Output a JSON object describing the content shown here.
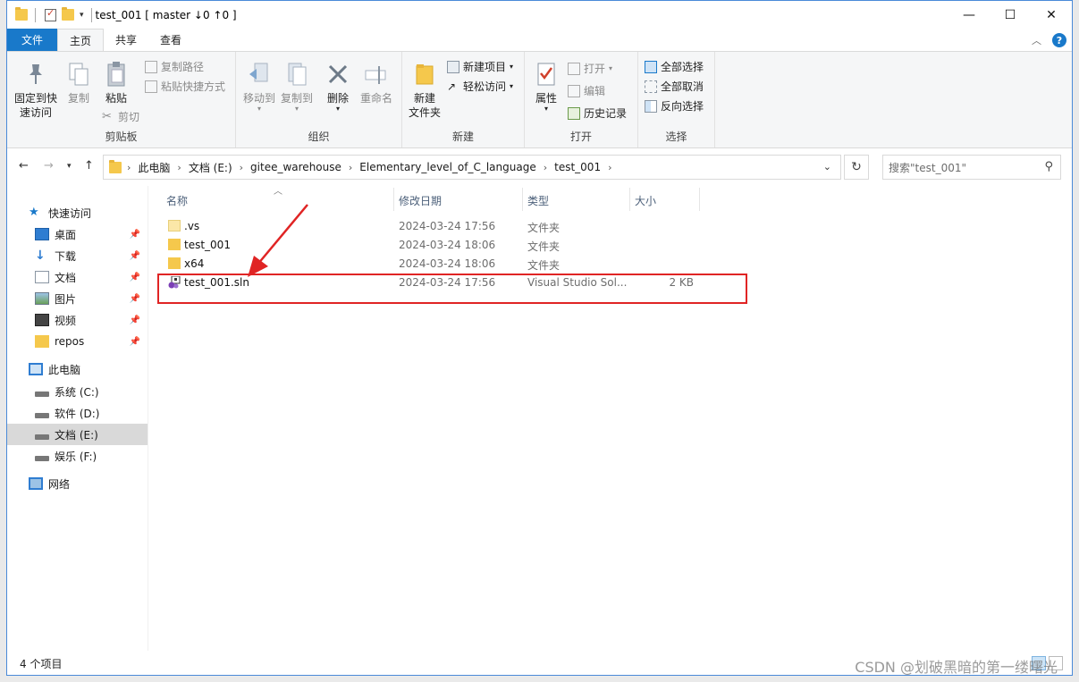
{
  "window": {
    "title": "test_001 [ master ↓0 ↑0 ]",
    "controls": {
      "minimize": "—",
      "maximize": "☐",
      "close": "✕"
    }
  },
  "ribbon_tabs": [
    {
      "label": "文件"
    },
    {
      "label": "主页"
    },
    {
      "label": "共享"
    },
    {
      "label": "查看"
    }
  ],
  "ribbon": {
    "clipboard": {
      "label": "剪贴板",
      "pin_quick_access": "固定到快\n速访问",
      "pin_line1": "固定到快",
      "pin_line2": "速访问",
      "copy": "复制",
      "paste": "粘贴",
      "copy_path": "复制路径",
      "paste_shortcut": "粘贴快捷方式",
      "cut": "剪切"
    },
    "organize": {
      "label": "组织",
      "move_to": "移动到",
      "copy_to": "复制到",
      "delete": "删除",
      "rename": "重命名"
    },
    "new": {
      "label": "新建",
      "new_folder_line1": "新建",
      "new_folder_line2": "文件夹",
      "new_item": "新建项目",
      "easy_access": "轻松访问"
    },
    "open": {
      "label": "打开",
      "properties": "属性",
      "open": "打开",
      "edit": "编辑",
      "history": "历史记录"
    },
    "select": {
      "label": "选择",
      "select_all": "全部选择",
      "select_none": "全部取消",
      "invert": "反向选择"
    }
  },
  "address": {
    "breadcrumbs": [
      "此电脑",
      "文档 (E:)",
      "gitee_warehouse",
      "Elementary_level_of_C_language",
      "test_001"
    ],
    "search_placeholder": "搜索\"test_001\""
  },
  "nav_pane": {
    "quick_access": "快速访问",
    "quick_items": [
      {
        "label": "桌面",
        "icon": "desktop-icon"
      },
      {
        "label": "下载",
        "icon": "download-icon"
      },
      {
        "label": "文档",
        "icon": "documents-icon"
      },
      {
        "label": "图片",
        "icon": "pictures-icon"
      },
      {
        "label": "视频",
        "icon": "videos-icon"
      },
      {
        "label": "repos",
        "icon": "folder-icon"
      }
    ],
    "this_pc": "此电脑",
    "drives": [
      {
        "label": "系统 (C:)"
      },
      {
        "label": "软件 (D:)"
      },
      {
        "label": "文档 (E:)",
        "selected": true
      },
      {
        "label": "娱乐 (F:)"
      }
    ],
    "network": "网络"
  },
  "file_list": {
    "columns": [
      "名称",
      "修改日期",
      "类型",
      "大小"
    ],
    "rows": [
      {
        "name": ".vs",
        "date": "2024-03-24 17:56",
        "type": "文件夹",
        "size": ""
      },
      {
        "name": "test_001",
        "date": "2024-03-24 18:06",
        "type": "文件夹",
        "size": ""
      },
      {
        "name": "x64",
        "date": "2024-03-24 18:06",
        "type": "文件夹",
        "size": ""
      },
      {
        "name": "test_001.sln",
        "date": "2024-03-24 17:56",
        "type": "Visual Studio Sol...",
        "size": "2 KB"
      }
    ]
  },
  "status": {
    "item_count": "4 个项目"
  },
  "watermark": "CSDN @划破黑暗的第一缕曙光",
  "colors": {
    "accent": "#1979ca",
    "highlight": "#e02424",
    "folder": "#f5c84c",
    "selected": "#cce4f7"
  }
}
